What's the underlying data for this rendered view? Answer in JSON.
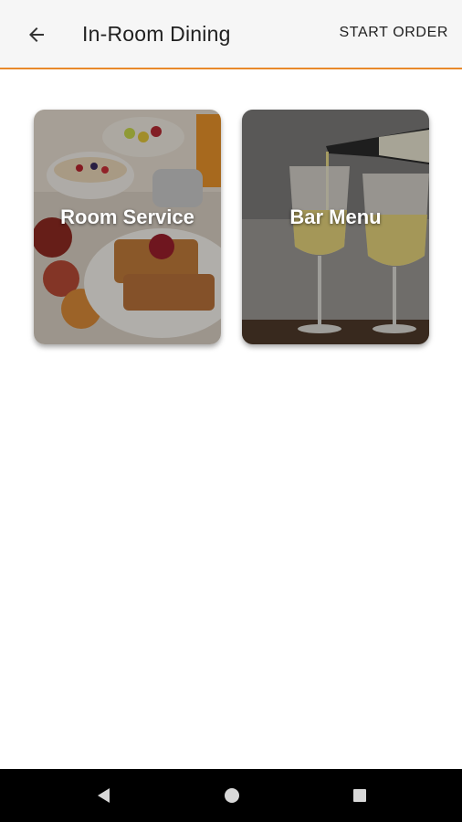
{
  "appbar": {
    "title": "In-Room Dining",
    "action_label": "START ORDER",
    "accent_color": "#e8892b",
    "back_icon": "arrow-left-icon"
  },
  "cards": [
    {
      "label": "Room Service",
      "image": "breakfast-food-photo"
    },
    {
      "label": "Bar Menu",
      "image": "white-wine-glasses-photo"
    }
  ],
  "navbar": {
    "back_icon": "triangle-back-icon",
    "home_icon": "circle-home-icon",
    "recents_icon": "square-recents-icon"
  }
}
